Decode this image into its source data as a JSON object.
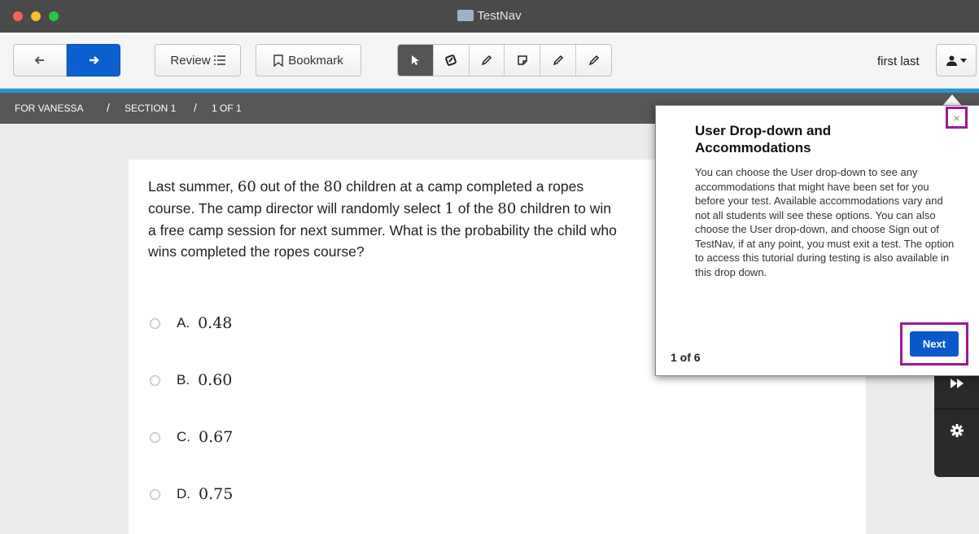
{
  "window": {
    "title": "TestNav"
  },
  "toolbar": {
    "back_icon": "arrow-left-icon",
    "forward_icon": "arrow-right-icon",
    "review_label": "Review",
    "bookmark_label": "Bookmark",
    "tools": [
      "pointer-icon",
      "eraser-icon",
      "pencil-icon",
      "note-icon",
      "pencil-icon",
      "pencil-icon"
    ],
    "user_name": "first last"
  },
  "breadcrumb": {
    "items": [
      "FOR VANESSA",
      "SECTION 1",
      "1 OF 1"
    ],
    "separator": "/"
  },
  "question": {
    "parts": [
      "Last summer, ",
      "60",
      " out of the ",
      "80",
      " children at a camp completed a ropes course. The camp director will randomly select ",
      "1",
      " of the ",
      "80",
      " children to win a free camp session for next summer. What is the probability the child who wins completed the ropes course?"
    ],
    "choices": [
      {
        "letter": "A.",
        "value": "0.48"
      },
      {
        "letter": "B.",
        "value": "0.60"
      },
      {
        "letter": "C.",
        "value": "0.67"
      },
      {
        "letter": "D.",
        "value": "0.75"
      }
    ]
  },
  "popup": {
    "title": "User Drop-down and Accommodations",
    "body": "You can choose the User drop-down to see any accommodations that might have been set for you before your test. Available accommodations vary and not all students will see these options. You can also choose the User drop-down, and choose Sign out of TestNav, if at any point, you must exit a test. The option to access this tutorial during testing is also available in this drop down.",
    "count": "1 of 6",
    "next_label": "Next",
    "close_label": "×"
  },
  "colors": {
    "forward_button": "#0c5fcf",
    "accent_line": "#2196d8",
    "highlight": "#9b1a97",
    "next_button": "#0a58cc"
  }
}
